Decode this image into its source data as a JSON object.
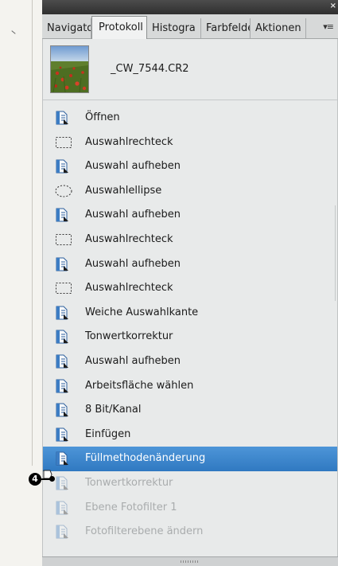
{
  "panel": {
    "close_symbol": "×",
    "tabs": [
      {
        "label": "Navigato",
        "active": false
      },
      {
        "label": "Protokoll",
        "active": true
      },
      {
        "label": "Histogra",
        "active": false
      },
      {
        "label": "Farbfelde",
        "active": false
      },
      {
        "label": "Aktionen",
        "active": false
      }
    ],
    "tab_menu_symbol": "▾≡"
  },
  "snapshot": {
    "label": "_CW_7544.CR2"
  },
  "history": [
    {
      "label": "Öffnen",
      "icon": "document-step-icon",
      "state": "normal"
    },
    {
      "label": "Auswahlrechteck",
      "icon": "rect-marquee-icon",
      "state": "normal"
    },
    {
      "label": "Auswahl aufheben",
      "icon": "document-step-icon",
      "state": "normal"
    },
    {
      "label": "Auswahlellipse",
      "icon": "ellipse-marquee-icon",
      "state": "normal"
    },
    {
      "label": "Auswahl aufheben",
      "icon": "document-step-icon",
      "state": "normal"
    },
    {
      "label": "Auswahlrechteck",
      "icon": "rect-marquee-icon",
      "state": "normal"
    },
    {
      "label": "Auswahl aufheben",
      "icon": "document-step-icon",
      "state": "normal"
    },
    {
      "label": "Auswahlrechteck",
      "icon": "rect-marquee-icon",
      "state": "normal"
    },
    {
      "label": "Weiche Auswahlkante",
      "icon": "document-step-icon",
      "state": "normal"
    },
    {
      "label": "Tonwertkorrektur",
      "icon": "document-step-icon",
      "state": "normal"
    },
    {
      "label": "Auswahl aufheben",
      "icon": "document-step-icon",
      "state": "normal"
    },
    {
      "label": "Arbeitsfläche wählen",
      "icon": "document-step-icon",
      "state": "normal"
    },
    {
      "label": "8 Bit/Kanal",
      "icon": "document-step-icon",
      "state": "normal"
    },
    {
      "label": "Einfügen",
      "icon": "document-step-icon",
      "state": "normal"
    },
    {
      "label": "Füllmethodenänderung",
      "icon": "document-step-icon",
      "state": "selected"
    },
    {
      "label": "Tonwertkorrektur",
      "icon": "document-step-icon",
      "state": "greyed"
    },
    {
      "label": "Ebene Fotofilter 1",
      "icon": "document-step-icon",
      "state": "greyed"
    },
    {
      "label": "Fotofilterebene ändern",
      "icon": "document-step-icon",
      "state": "greyed"
    }
  ],
  "callout": {
    "number": "4"
  },
  "colors": {
    "selection": "#3d87cf",
    "panel_bar": "#3a3a3a",
    "greyed_text": "#a9acad"
  }
}
